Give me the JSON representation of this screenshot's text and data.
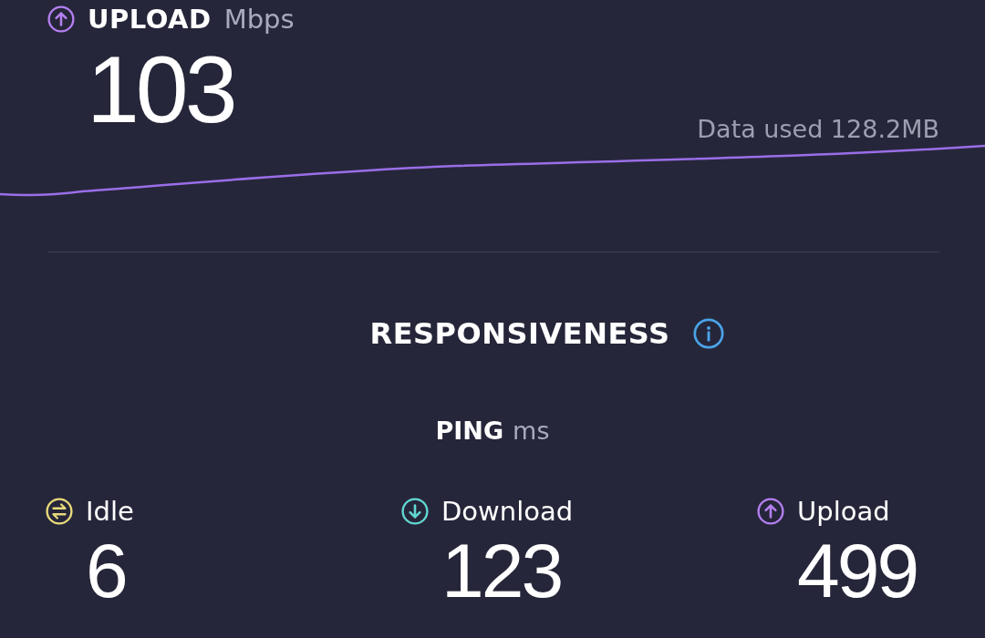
{
  "upload": {
    "label": "UPLOAD",
    "unit": "Mbps",
    "value": "103"
  },
  "data_used": "Data used 128.2MB",
  "responsiveness": {
    "title": "RESPONSIVENESS"
  },
  "ping": {
    "label": "PING",
    "unit": "ms",
    "metrics": [
      {
        "kind": "idle",
        "label": "Idle",
        "value": "6",
        "color": "#e8da7a"
      },
      {
        "kind": "download",
        "label": "Download",
        "value": "123",
        "color": "#62d8d2"
      },
      {
        "kind": "upload",
        "label": "Upload",
        "value": "499",
        "color": "#b47ff0"
      }
    ]
  }
}
